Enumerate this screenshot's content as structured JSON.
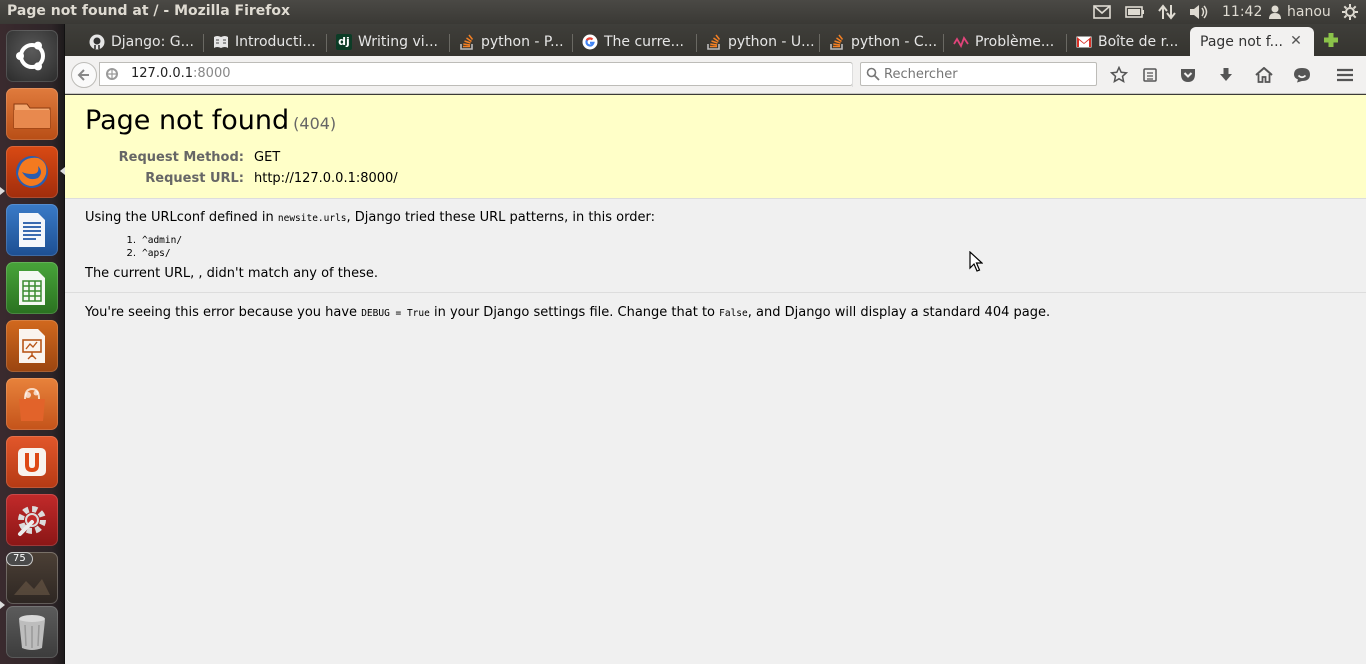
{
  "os": {
    "window_title": "Page not found at / - Mozilla Firefox",
    "clock": "11:42",
    "user": "hanou",
    "launcher_badge": "75",
    "launcher_items": [
      "ubuntu-dash",
      "files",
      "firefox",
      "libreoffice-writer",
      "libreoffice-calc",
      "libreoffice-impress",
      "software-center",
      "ubuntu-one",
      "system-settings",
      "workspace-switcher",
      "trash"
    ]
  },
  "browser": {
    "tabs": [
      {
        "label": "Django: G...",
        "icon": "github-icon"
      },
      {
        "label": "Introducti...",
        "icon": "book-icon"
      },
      {
        "label": "Writing vi...",
        "icon": "django-icon"
      },
      {
        "label": "python - P...",
        "icon": "stackoverflow-icon"
      },
      {
        "label": "The curre...",
        "icon": "google-icon"
      },
      {
        "label": "python - U...",
        "icon": "stackoverflow-icon"
      },
      {
        "label": "python - C...",
        "icon": "stackoverflow-icon"
      },
      {
        "label": "Problème...",
        "icon": "pulse-icon"
      },
      {
        "label": "Boîte de r...",
        "icon": "gmail-icon"
      },
      {
        "label": "Page not f...",
        "icon": "",
        "active": true
      }
    ],
    "url_host": "127.0.0.1",
    "url_port": ":8000",
    "search_placeholder": "Rechercher"
  },
  "page": {
    "title": "Page not found",
    "status_code": "(404)",
    "request_method_label": "Request Method:",
    "request_method": "GET",
    "request_url_label": "Request URL:",
    "request_url": "http://127.0.0.1:8000/",
    "info_prefix": "Using the URLconf defined in ",
    "urlconf_module": "newsite.urls",
    "info_suffix": ", Django tried these URL patterns, in this order:",
    "patterns": [
      {
        "num": "1.",
        "pattern": "^admin/"
      },
      {
        "num": "2.",
        "pattern": "^aps/"
      }
    ],
    "current_url_message": "The current URL, , didn't match any of these.",
    "explanation_prefix": "You're seeing this error because you have ",
    "debug_setting": "DEBUG = True",
    "explanation_middle": " in your Django settings file. Change that to ",
    "false_value": "False",
    "explanation_suffix": ", and Django will display a standard 404 page."
  }
}
